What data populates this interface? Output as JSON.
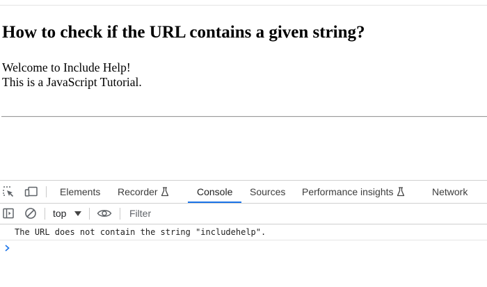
{
  "page": {
    "heading": "How to check if the URL contains a given string?",
    "line1": "Welcome to Include Help!",
    "line2": "This is a JavaScript Tutorial."
  },
  "devtools": {
    "toolbar_icons": [
      "inspect-element-icon",
      "device-toolbar-icon"
    ],
    "tabs": [
      {
        "label": "Elements",
        "active": false
      },
      {
        "label": "Recorder",
        "active": false,
        "icon": "flask-icon"
      },
      {
        "label": "Console",
        "active": true
      },
      {
        "label": "Sources",
        "active": false
      },
      {
        "label": "Performance insights",
        "active": false,
        "icon": "flask-icon"
      },
      {
        "label": "Network",
        "active": false
      }
    ],
    "console_toolbar": {
      "icons": [
        "sidebar-toggle-icon",
        "clear-console-icon",
        "eye-icon"
      ],
      "context": "top",
      "filter_placeholder": "Filter",
      "filter_value": ""
    },
    "messages": [
      "The URL does not contain the string \"includehelp\"."
    ],
    "accent_color": "#1a73e8"
  }
}
